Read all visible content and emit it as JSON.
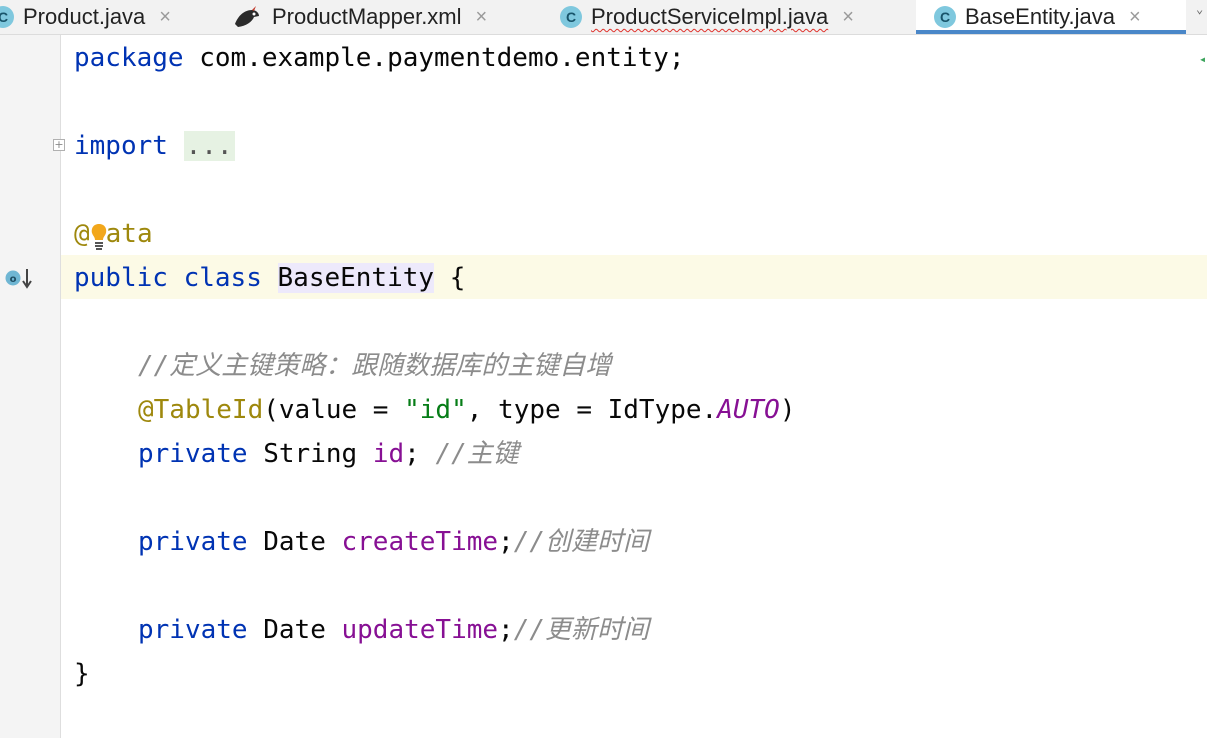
{
  "tabs": [
    {
      "label": "Product.java",
      "icon": "class-icon",
      "active": false
    },
    {
      "label": "ProductMapper.xml",
      "icon": "mybatis-bird-icon",
      "active": false
    },
    {
      "label": "ProductServiceImpl.java",
      "icon": "class-icon",
      "active": false,
      "error": true
    },
    {
      "label": "BaseEntity.java",
      "icon": "class-icon",
      "active": true
    }
  ],
  "tab_icon_letter": "C",
  "tab_close_glyph": "×",
  "code": {
    "l1_kw": "package",
    "l1_rest": " com.example.paymentdemo.entity;",
    "l2_kw": "import",
    "l2_dots": "...",
    "l3_at": "@",
    "l3_rest": "ata",
    "l4_public": "public",
    "l4_class": "class",
    "l4_name": "BaseEntity",
    "l4_brace": " {",
    "l5_comment": "//定义主键策略：跟随数据库的主键自增",
    "l6_ann": "@TableId",
    "l6_a": "(value = ",
    "l6_str": "\"id\"",
    "l6_b": ", type = IdType.",
    "l6_const": "AUTO",
    "l6_c": ")",
    "l7_kw": "private",
    "l7_type": " String ",
    "l7_field": "id",
    "l7_semi": "; ",
    "l7_comment": "//主键",
    "l8_kw": "private",
    "l8_type": " Date ",
    "l8_field": "createTime",
    "l8_semi": ";",
    "l8_comment": "//创建时间",
    "l9_kw": "private",
    "l9_type": " Date ",
    "l9_field": "updateTime",
    "l9_semi": ";",
    "l9_comment": "//更新时间",
    "l10_brace": "}"
  },
  "gutter": {
    "fold_glyph": "+",
    "impl_icon": "implemented-down-arrow-icon"
  },
  "colors": {
    "keyword": "#0033b3",
    "annotation": "#9e880d",
    "string": "#067d17",
    "field": "#871094",
    "comment": "#8c8c8c",
    "active_tab_underline": "#4a87c8",
    "caret_line": "#fcfae6"
  }
}
